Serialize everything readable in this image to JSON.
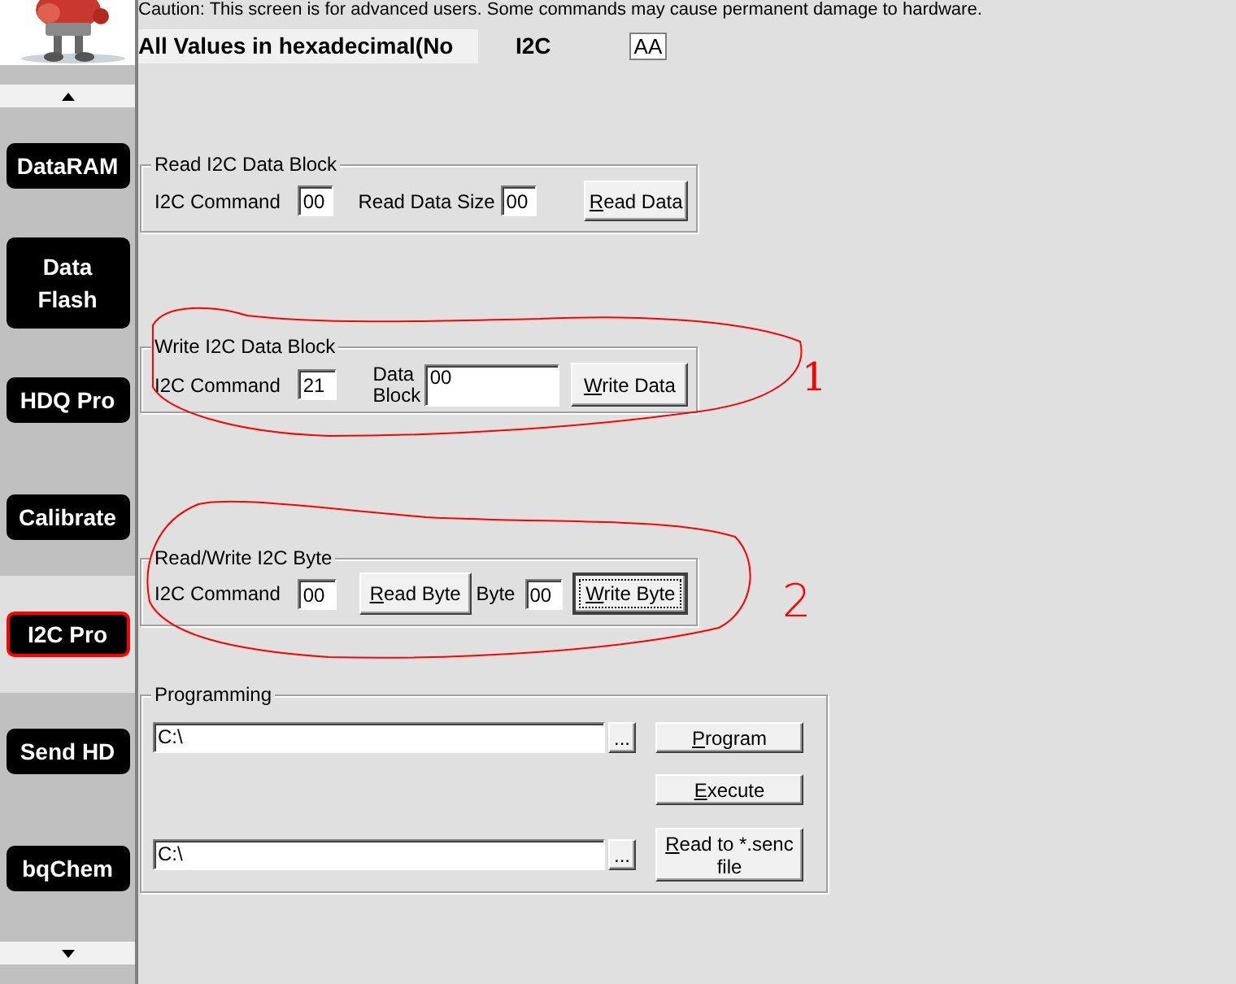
{
  "sidebar": {
    "items": [
      {
        "label": "DataRAM",
        "selected": false
      },
      {
        "label": "Data Flash",
        "selected": false
      },
      {
        "label": "HDQ Pro",
        "selected": false
      },
      {
        "label": "Calibrate",
        "selected": false
      },
      {
        "label": "I2C Pro",
        "selected": true
      },
      {
        "label": "Send HD",
        "selected": false
      },
      {
        "label": "bqChem",
        "selected": false
      }
    ]
  },
  "caution": "Caution: This screen is for advanced users. Some commands may cause permanent damage to hardware.",
  "header": {
    "hex_note": "All Values in hexadecimal(No",
    "i2c_label": "I2C",
    "i2c_address": "AA"
  },
  "groups": [
    {
      "title": "Read I2C Data Block",
      "rows": [
        [
          {
            "kind": "label",
            "text": "I2C Command"
          },
          {
            "kind": "input",
            "value": "00"
          },
          {
            "kind": "label",
            "text": "Read Data Size"
          },
          {
            "kind": "input",
            "value": "00"
          },
          {
            "kind": "button",
            "text": "Read Data",
            "mnemonic": true,
            "focused": false
          }
        ]
      ]
    },
    {
      "title": "Write I2C Data Block",
      "rows": [
        [
          {
            "kind": "label",
            "text": "I2C Command"
          },
          {
            "kind": "input",
            "value": "21"
          },
          {
            "kind": "label2",
            "text": "Data Block"
          },
          {
            "kind": "block",
            "value": "00"
          },
          {
            "kind": "button",
            "text": "Write Data",
            "mnemonic": true,
            "focused": false
          }
        ]
      ]
    },
    {
      "title": "Read/Write I2C Byte",
      "rows": [
        [
          {
            "kind": "label",
            "text": "I2C Command"
          },
          {
            "kind": "input",
            "value": "00"
          },
          {
            "kind": "button",
            "text": "Read Byte",
            "mnemonic": true,
            "focused": false
          },
          {
            "kind": "label",
            "text": "Byte"
          },
          {
            "kind": "input",
            "value": "00"
          },
          {
            "kind": "button",
            "text": "Write Byte",
            "mnemonic": true,
            "focused": true
          }
        ]
      ]
    },
    {
      "title": "Programming",
      "rows": [
        [
          {
            "kind": "path",
            "value": "C:\\"
          },
          {
            "kind": "browse",
            "text": "..."
          },
          {
            "kind": "wide-button",
            "text": "Program",
            "mnemonic": true,
            "focused": false
          }
        ],
        [
          "",
          "",
          {
            "kind": "wide-button",
            "text": "Execute",
            "mnemonic": true,
            "focused": false
          }
        ],
        [
          {
            "kind": "path",
            "value": "C:\\"
          },
          {
            "kind": "browse",
            "text": "..."
          },
          {
            "kind": "tall-button",
            "text": "Read to *.senc file",
            "mnemonic": true,
            "focused": false
          }
        ]
      ]
    }
  ],
  "annotations": [
    {
      "label": "1"
    },
    {
      "label": "2"
    }
  ]
}
